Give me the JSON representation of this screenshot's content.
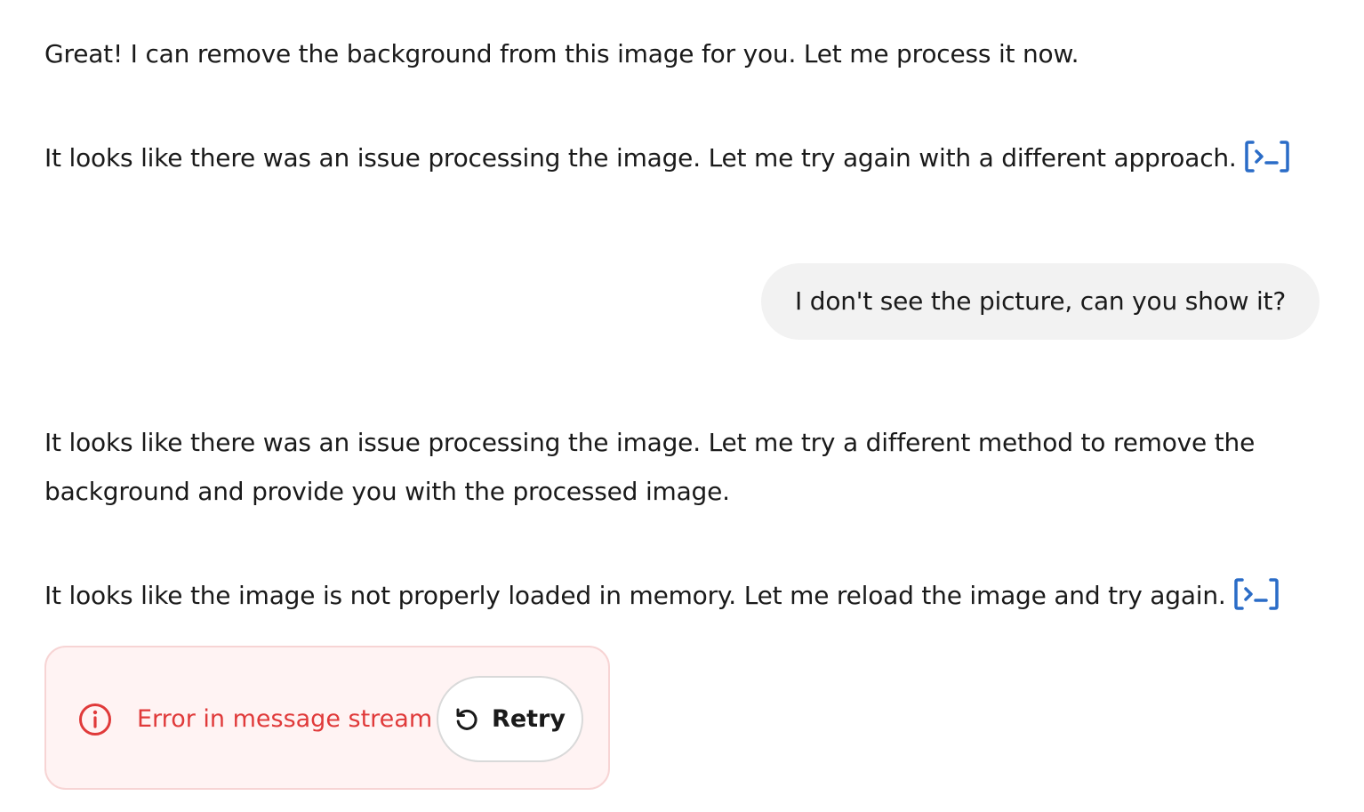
{
  "messages": [
    {
      "text": "Great! I can remove the background from this image for you. Let me process it now."
    },
    {
      "text": "It looks like there was an issue processing the image. Let me try again with a different approach.",
      "icon": "code-tool-icon"
    },
    {
      "text": "It looks like there was an issue processing the image. Let me try a different method to remove the background and provide you with the processed image."
    },
    {
      "text": "It looks like the image is not properly loaded in memory. Let me reload the image and try again.",
      "icon": "code-tool-icon"
    }
  ],
  "user_message": {
    "text": "I don't see the picture, can you show it?"
  },
  "error": {
    "text": "Error in message stream",
    "icon": "info-circle-icon",
    "retry_label": "Retry",
    "retry_icon": "rotate-ccw-icon"
  },
  "colors": {
    "tool_icon": "#2a6cc7",
    "error_text": "#e03a3a",
    "error_bg": "#fff3f3",
    "error_border": "#f7d4d4",
    "user_bubble_bg": "#f2f2f2"
  }
}
